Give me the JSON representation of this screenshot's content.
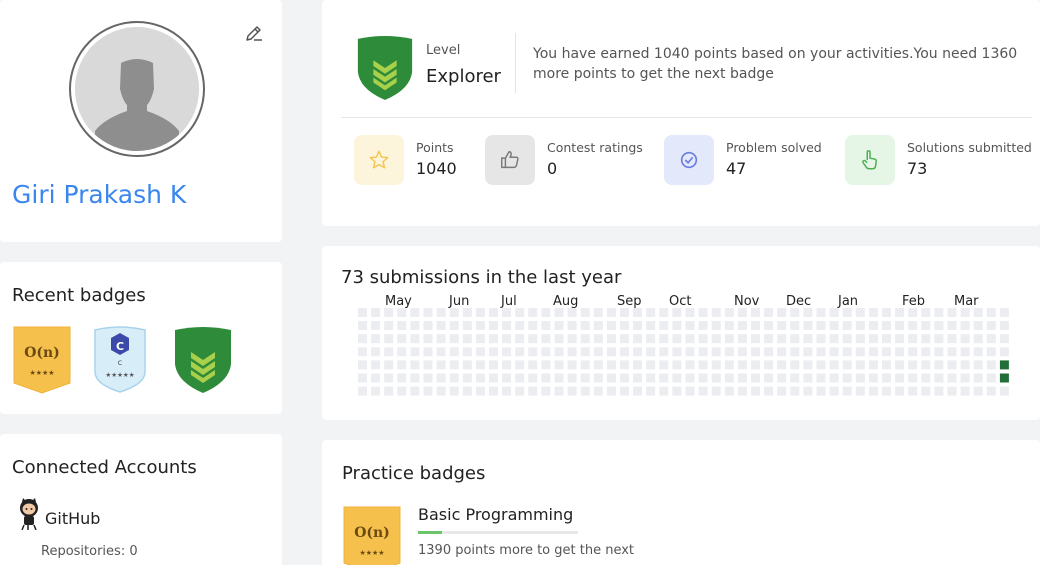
{
  "profile": {
    "name": "Giri Prakash K",
    "edit_icon": "edit-pencil-icon",
    "avatar_icon": "default-user-avatar-icon"
  },
  "recent_badges": {
    "title": "Recent badges",
    "items": [
      {
        "icon": "big-o-badge-icon",
        "text": "O(n)",
        "stars": "★★★★"
      },
      {
        "icon": "c-language-badge-icon",
        "letter": "C",
        "sub": "C",
        "stars": "★★★★★"
      },
      {
        "icon": "explorer-shield-badge-icon"
      }
    ]
  },
  "connected_accounts": {
    "title": "Connected Accounts",
    "github_label": "GitHub",
    "repositories": "Repositories: 0"
  },
  "level": {
    "label": "Level",
    "value": "Explorer",
    "message": "You have earned 1040 points based on your activities.You need 1360 more points to get the next badge"
  },
  "stats": [
    {
      "label": "Points",
      "value": "1040",
      "icon": "star-icon",
      "color": "#f5c451",
      "bg": "#fdf4dc"
    },
    {
      "label": "Contest ratings",
      "value": "0",
      "icon": "thumbs-up-icon",
      "color": "#7a7a7a",
      "bg": "#e6e6e6"
    },
    {
      "label": "Problem solved",
      "value": "47",
      "icon": "check-circle-icon",
      "color": "#6a7ee0",
      "bg": "#e3e8fb"
    },
    {
      "label": "Solutions submitted",
      "value": "73",
      "icon": "pointer-hand-icon",
      "color": "#4caf50",
      "bg": "#e5f5e6"
    }
  ],
  "heatmap": {
    "title": "73 submissions in the last year",
    "months": [
      "May",
      "Jun",
      "Jul",
      "Aug",
      "Sep",
      "Oct",
      "Nov",
      "Dec",
      "Jan",
      "Feb",
      "Mar"
    ],
    "empty_color": "#ebedf0",
    "active_color": "#216e39",
    "weeks": 50,
    "days": 7,
    "active_cells": [
      [
        49,
        4
      ],
      [
        49,
        5
      ]
    ]
  },
  "practice": {
    "title": "Practice badges",
    "badge": {
      "text": "O(n)",
      "stars": "★★★★"
    },
    "name": "Basic Programming",
    "progress": 0.15,
    "message": "1390 points more to get the next"
  },
  "colors": {
    "accent": "#3a86ee",
    "badge_gold": "#f6c04d",
    "shield_green": "#2e8b3a"
  }
}
